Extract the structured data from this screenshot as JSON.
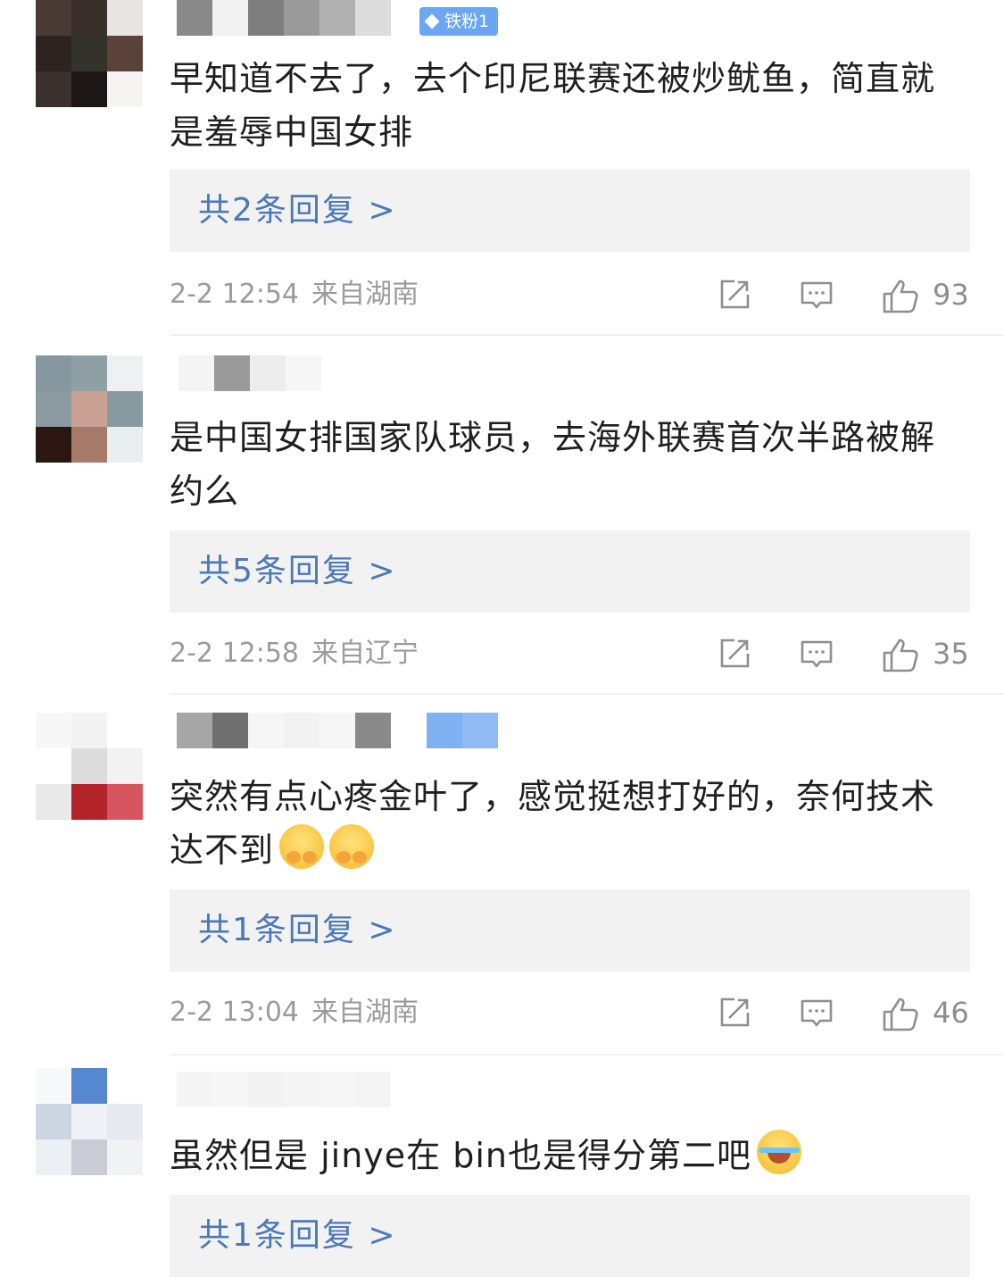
{
  "comments": [
    {
      "badge": "铁粉1",
      "text": "早知道不去了，去个印尼联赛还被炒鱿鱼，简直就是羞辱中国女排",
      "replies_label": "共2条回复 >",
      "time": "2-2 12:54",
      "location": "来自湖南",
      "likes": "93",
      "avatar_colors": [
        "#4a3a35",
        "#3a2f2a",
        "#e8e6e2",
        "#2d241f",
        "#33332c",
        "#5a4238",
        "#3a302d",
        "#1e1614",
        "#f5f4f2"
      ],
      "name_colors": [
        "#8a8a8a",
        "#f2f2f2",
        "#7e7e7e",
        "#9a9a9a",
        "#b0b0b0",
        "#dcdcdc"
      ]
    },
    {
      "badge": "",
      "text": "是中国女排国家队球员，去海外联赛首次半路被解约么",
      "replies_label": "共5条回复 >",
      "time": "2-2 12:58",
      "location": "来自辽宁",
      "likes": "35",
      "avatar_colors": [
        "#86989f",
        "#8ea0a6",
        "#eef1f2",
        "#8b9aa0",
        "#c9a195",
        "#879aa1",
        "#2a1711",
        "#a67a68",
        "#e8eef0"
      ],
      "name_colors": [
        "#f4f4f4",
        "#9a9a9a",
        "#ededed",
        "#f6f6f6"
      ]
    },
    {
      "badge": "",
      "text": "突然有点心疼金叶了，感觉挺想打好的，奈何技术达不到",
      "emoji": [
        "shy",
        "shy"
      ],
      "replies_label": "共1条回复 >",
      "time": "2-2 13:04",
      "location": "来自湖南",
      "likes": "46",
      "avatar_colors": [
        "#f7f7f7",
        "#f3f3f3",
        "#ffffff",
        "#ffffff",
        "#dcdcdc",
        "#f2f2f2",
        "#e9e9e9",
        "#b3242a",
        "#d65560"
      ],
      "name_colors": [
        "#a6a6a6",
        "#707070",
        "#f6f6f6",
        "#f2f2f2",
        "#f6f6f6",
        "#8a8a8a",
        "#ffffff",
        "#7fb2f2",
        "#8fbaf4"
      ]
    },
    {
      "badge": "",
      "text": "虽然但是 jinye在 bin也是得分第二吧",
      "emoji": [
        "laugh"
      ],
      "replies_label": "共1条回复 >",
      "avatar_colors": [
        "#f7f8fa",
        "#5588d0",
        "#ffffff",
        "#ccd6e3",
        "#eef1f5",
        "#e6e9ef",
        "#eceff3",
        "#c9ccd6",
        "#f1f2f4"
      ],
      "name_colors": [
        "#f5f5f5",
        "#f7f7f7",
        "#f3f3f3",
        "#f5f5f5",
        "#f6f6f6",
        "#f4f4f4"
      ]
    }
  ],
  "icons": {
    "share": "share-icon",
    "comment": "comment-icon",
    "like": "thumbs-up-icon"
  },
  "colors": {
    "reply_link": "#4b78b8",
    "reply_bg": "#f2f2f2",
    "meta_text": "#9b9b9b",
    "badge_bg": "#6aa6f2"
  }
}
